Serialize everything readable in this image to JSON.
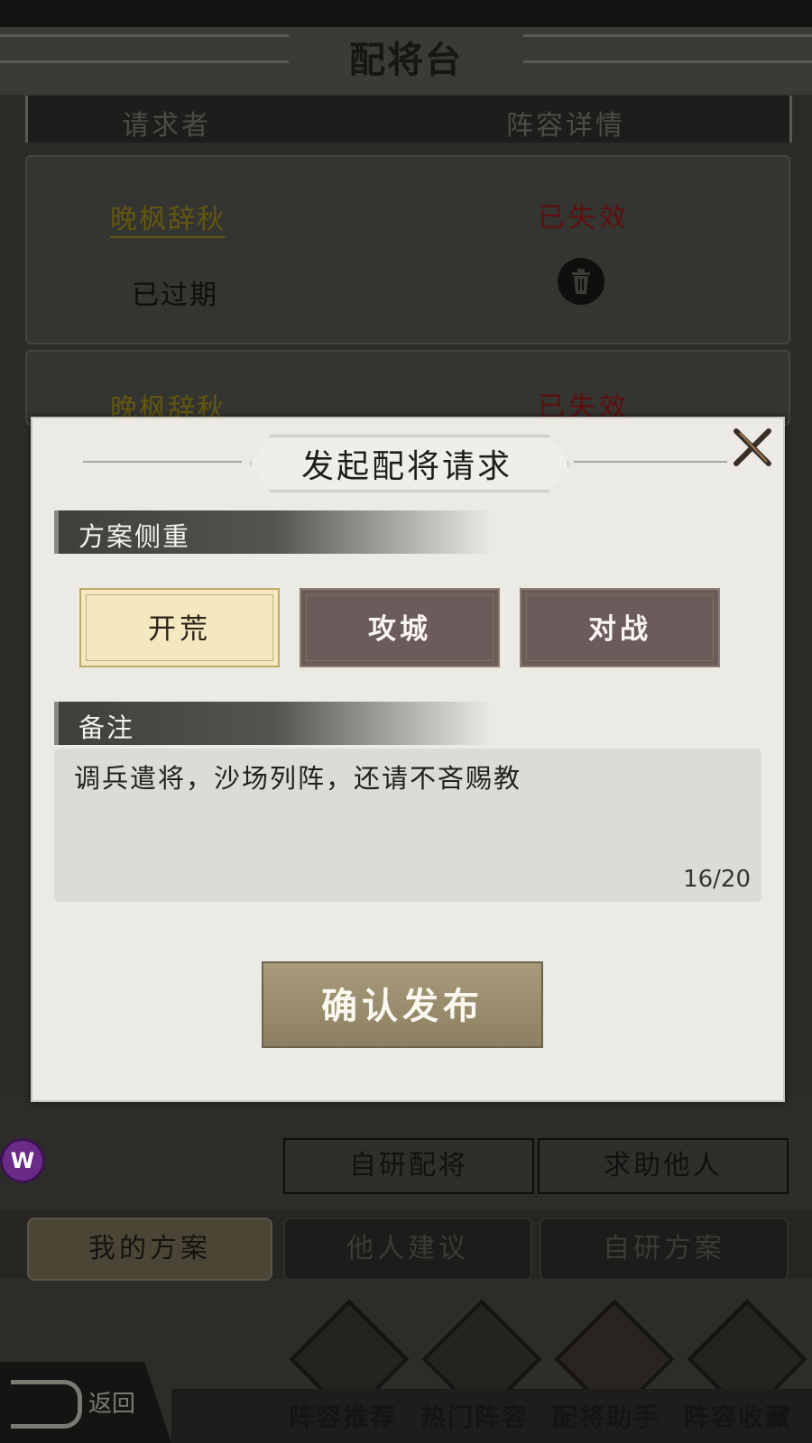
{
  "header": {
    "title": "配将台"
  },
  "table": {
    "col_requester": "请求者",
    "col_details": "阵容详情",
    "rows": [
      {
        "name": "晚枫辞秋",
        "state": "已失效",
        "status": "已过期"
      },
      {
        "name": "晚枫辞秋",
        "state": "已失效"
      }
    ]
  },
  "modal": {
    "title": "发起配将请求",
    "focus_section": "方案侧重",
    "options": [
      "开荒",
      "攻城",
      "对战"
    ],
    "selected_option": "开荒",
    "note_section": "备注",
    "note_value": "调兵遣将，沙场列阵，还请不吝赐教",
    "note_counter": "16/20",
    "confirm_label": "确认发布"
  },
  "actions": {
    "self_study": "自研配将",
    "ask_help": "求助他人"
  },
  "tabs": [
    "我的方案",
    "他人建议",
    "自研方案"
  ],
  "active_tab": "我的方案",
  "bottom_nav": {
    "back_label": "返回",
    "items": [
      "阵容推荐",
      "热门阵容",
      "配将助手",
      "阵容收藏"
    ]
  },
  "overlay_badge": "W",
  "colors": {
    "modal_bg": "#ebeae4",
    "selected_option": "#f4e8c0",
    "unselected_option": "#6c5b5b",
    "confirm": "#9a8e6f",
    "expired_red": "#5e0f0f"
  }
}
